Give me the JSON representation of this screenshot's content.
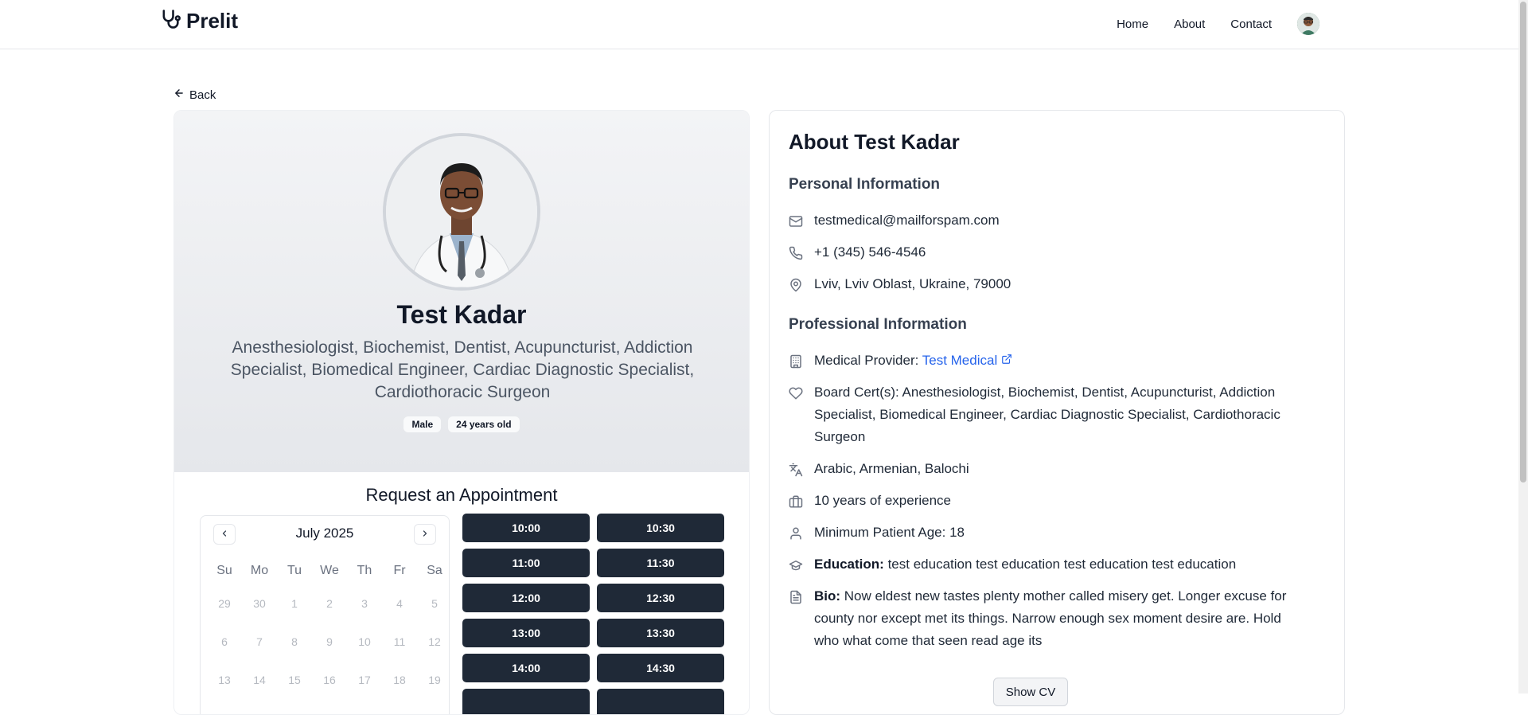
{
  "header": {
    "logo_text": "Prelit",
    "nav": {
      "home": "Home",
      "about": "About",
      "contact": "Contact"
    }
  },
  "back_label": "Back",
  "profile": {
    "name": "Test Kadar",
    "specialties": "Anesthesiologist, Biochemist, Dentist, Acupuncturist, Addiction Specialist, Biomedical Engineer, Cardiac Diagnostic Specialist, Cardiothoracic Surgeon",
    "badges": [
      "Male",
      "24 years old"
    ]
  },
  "appointment": {
    "title": "Request an Appointment",
    "calendar": {
      "month": "July 2025",
      "weekdays": [
        "Su",
        "Mo",
        "Tu",
        "We",
        "Th",
        "Fr",
        "Sa"
      ],
      "days": [
        "29",
        "30",
        "1",
        "2",
        "3",
        "4",
        "5",
        "6",
        "7",
        "8",
        "9",
        "10",
        "11",
        "12",
        "13",
        "14",
        "15",
        "16",
        "17",
        "18",
        "19"
      ]
    },
    "slots": [
      "10:00",
      "10:30",
      "11:00",
      "11:30",
      "12:00",
      "12:30",
      "13:00",
      "13:30",
      "14:00",
      "14:30",
      "",
      ""
    ]
  },
  "about": {
    "title": "About Test Kadar",
    "personal_title": "Personal Information",
    "email": "testmedical@mailforspam.com",
    "phone": "+1 (345) 546-4546",
    "location": "Lviv, Lviv Oblast, Ukraine, 79000",
    "professional_title": "Professional Information",
    "provider_label": "Medical Provider:",
    "provider_link": "Test Medical",
    "board_certs": "Board Cert(s): Anesthesiologist, Biochemist, Dentist, Acupuncturist, Addiction Specialist, Biomedical Engineer, Cardiac Diagnostic Specialist, Cardiothoracic Surgeon",
    "languages": "Arabic, Armenian, Balochi",
    "experience": "10 years of experience",
    "min_age": "Minimum Patient Age: 18",
    "education_label": "Education:",
    "education": "test education test education test education test education",
    "bio_label": "Bio:",
    "bio": "Now eldest new tastes plenty mother called misery get. Longer excuse for county nor except met its things. Narrow enough sex moment desire are. Hold who what come that seen read age its",
    "cv_button": "Show CV"
  }
}
